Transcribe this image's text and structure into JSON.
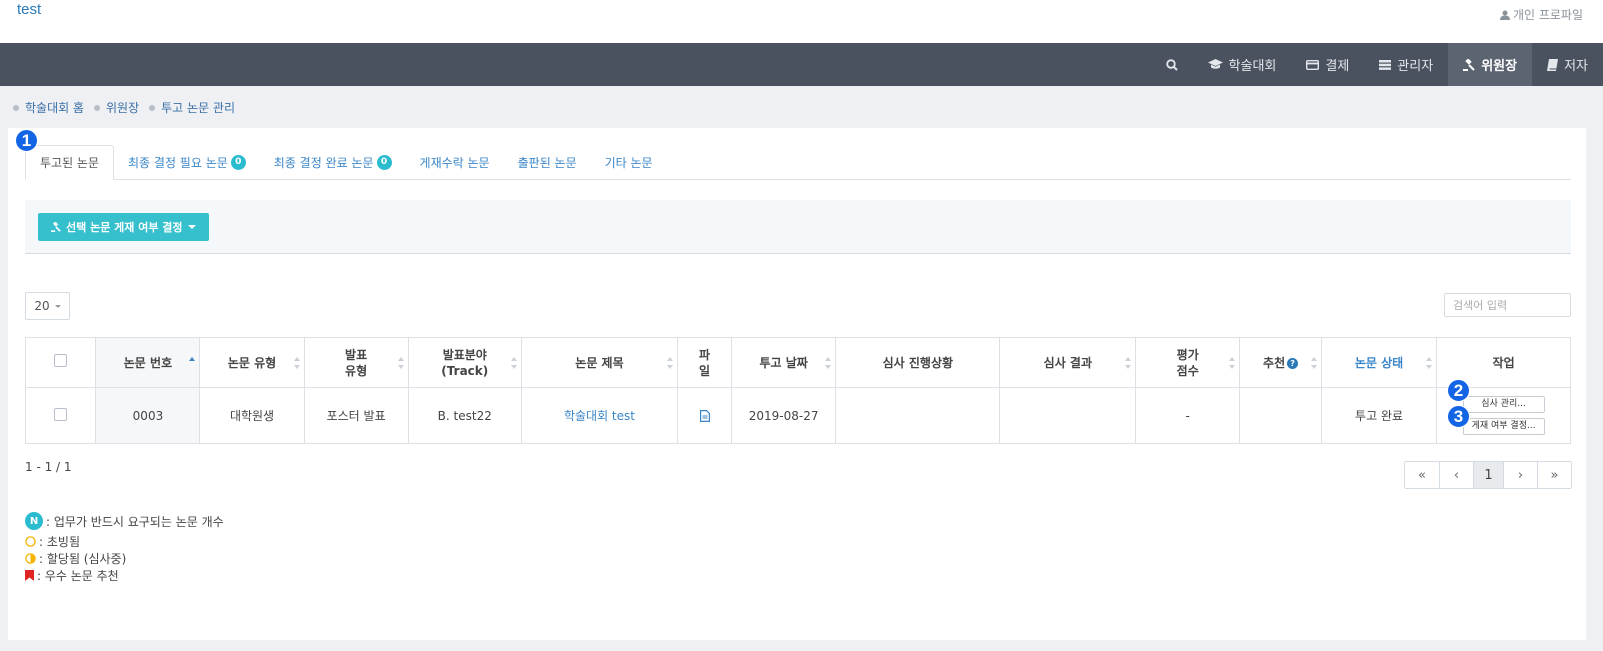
{
  "brand": "test",
  "profile": {
    "label": "개인 프로파일",
    "icon": "user-icon"
  },
  "nav": {
    "items": [
      {
        "label": "",
        "icon": "search-icon"
      },
      {
        "label": "학술대회",
        "icon": "graduation-cap-icon"
      },
      {
        "label": "결제",
        "icon": "credit-card-icon"
      },
      {
        "label": "관리자",
        "icon": "server-icon"
      },
      {
        "label": "위원장",
        "icon": "gavel-icon",
        "active": true
      },
      {
        "label": "저자",
        "icon": "book-icon"
      }
    ]
  },
  "breadcrumb": [
    "학술대회 홈",
    "위원장",
    "투고 논문 관리"
  ],
  "annotations": [
    "1",
    "2",
    "3"
  ],
  "tabs": [
    {
      "label": "투고된 논문",
      "active": true
    },
    {
      "label": "최종 결정 필요 논문",
      "count": "0"
    },
    {
      "label": "최종 결정 완료 논문",
      "count": "0"
    },
    {
      "label": "게재수락 논문"
    },
    {
      "label": "출판된 논문"
    },
    {
      "label": "기타 논문"
    }
  ],
  "toolbar": {
    "decide_label": "선택 논문 게재 여부 결정",
    "decide_icon": "gavel-icon"
  },
  "page_size": "20",
  "search_placeholder": "검색어 입력",
  "table": {
    "headers": {
      "paper_no": "논문 번호",
      "paper_type": "논문 유형",
      "pres_type": "발표\n유형",
      "track": "발표분야\n(Track)",
      "title": "논문 제목",
      "file": "파\n일",
      "date": "투고 날짜",
      "progress": "심사 진행상황",
      "result": "심사 결과",
      "score": "평가\n점수",
      "recommend": "추천",
      "status": "논문 상태",
      "action": "작업"
    },
    "rows": [
      {
        "paper_no": "0003",
        "paper_type": "대학원생",
        "pres_type": "포스터 발표",
        "track": "B. test22",
        "title": "학술대회 test",
        "file_icon": "file-icon",
        "date": "2019-08-27",
        "progress": "",
        "result": "",
        "score": "-",
        "recommend": "",
        "status": "투고 완료",
        "actions": [
          "심사 관리...",
          "게재 여부 결정..."
        ]
      }
    ]
  },
  "pagination": {
    "summary": "1 - 1 / 1",
    "first": "«",
    "prev": "‹",
    "current": "1",
    "next": "›",
    "last": "»"
  },
  "legend": [
    {
      "icon": "n-badge",
      "symbol": "N",
      "text": ": 업무가 반드시 요구되는 논문 개수"
    },
    {
      "icon": "empty-circle-icon",
      "text": ": 초빙됨"
    },
    {
      "icon": "half-circle-icon",
      "text": ": 할당됨 (심사중)"
    },
    {
      "icon": "bookmark-icon",
      "text": ": 우수 논문 추천"
    }
  ],
  "colors": {
    "accent": "#36c0ce",
    "navbar": "#4a5260",
    "link": "#3a86c8",
    "annotation": "#1464e6",
    "bookmark": "#e02424",
    "circle": "#f5b400"
  }
}
